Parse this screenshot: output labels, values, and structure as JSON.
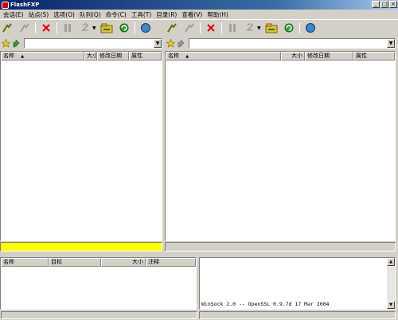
{
  "window": {
    "title": "FlashFXP"
  },
  "menu": [
    "会话(E)",
    "站点(S)",
    "选项(O)",
    "队列(Q)",
    "命令(C)",
    "工具(T)",
    "目录(R)",
    "查看(V)",
    "帮助(H)"
  ],
  "toolbar_icons": [
    "connect-icon",
    "disconnect-icon",
    "abort-icon",
    "pause-icon",
    "transfer-icon",
    "folder-icon",
    "refresh-icon",
    "globe-icon"
  ],
  "file_columns": [
    "名称",
    "大小",
    "修改日期",
    "属性"
  ],
  "sort_arrow": "▲",
  "queue_columns": [
    "名称",
    "目标",
    "大小",
    "注释"
  ],
  "log": {
    "line": "WinSock 2.0 -- OpenSSL 0.9.7d 17 Mar 2004"
  },
  "colors": {
    "title": "#0a246a",
    "transfer_status": "#ffff00"
  }
}
